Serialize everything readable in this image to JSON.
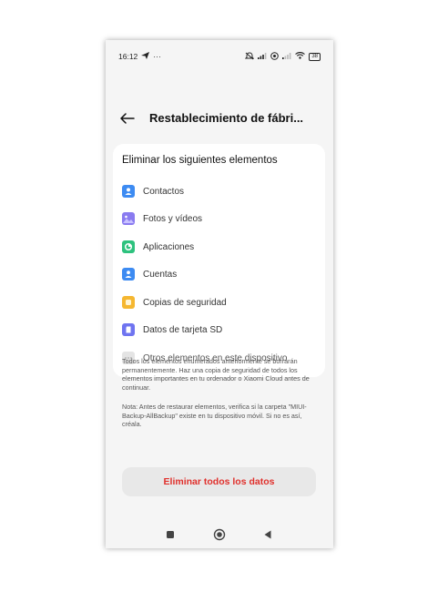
{
  "status_bar": {
    "time": "16:12",
    "left_extras": "···",
    "battery": "38",
    "icons": [
      "send-icon",
      "mute-icon",
      "signal-icon",
      "vpn-icon",
      "wifi-icon",
      "battery-icon"
    ]
  },
  "header": {
    "title": "Restablecimiento de fábri..."
  },
  "card": {
    "title": "Eliminar los siguientes elementos",
    "items": [
      {
        "label": "Contactos",
        "icon": "contacts-icon",
        "color": "#3d8bf2"
      },
      {
        "label": "Fotos y vídeos",
        "icon": "gallery-icon",
        "color": "#8a7bf0"
      },
      {
        "label": "Aplicaciones",
        "icon": "apps-icon",
        "color": "#2ec27e"
      },
      {
        "label": "Cuentas",
        "icon": "accounts-icon",
        "color": "#3d8bf2"
      },
      {
        "label": "Copias de seguridad",
        "icon": "backup-icon",
        "color": "#f5b731"
      },
      {
        "label": "Datos de tarjeta SD",
        "icon": "sd-card-icon",
        "color": "#6f74f0"
      },
      {
        "label": "Otros elementos en este dispositivo",
        "icon": "more-icon",
        "color": "#e4e4e4"
      }
    ]
  },
  "notes": {
    "warning": "Todos los elementos enumerados anteriormente se borrarán permanentemente. Haz una copia de seguridad de todos los elementos importantes en tu ordenador o Xiaomi Cloud antes de continuar.",
    "restore": "Nota: Antes de restaurar elementos, verifica si la carpeta \"MIUI-Backup-AllBackup\" existe en tu dispositivo móvil. Si no es así, créala."
  },
  "action": {
    "label": "Eliminar todos los datos",
    "color": "#e0302c"
  },
  "navbar": {
    "buttons": [
      "recents-button",
      "home-button",
      "back-button"
    ]
  }
}
